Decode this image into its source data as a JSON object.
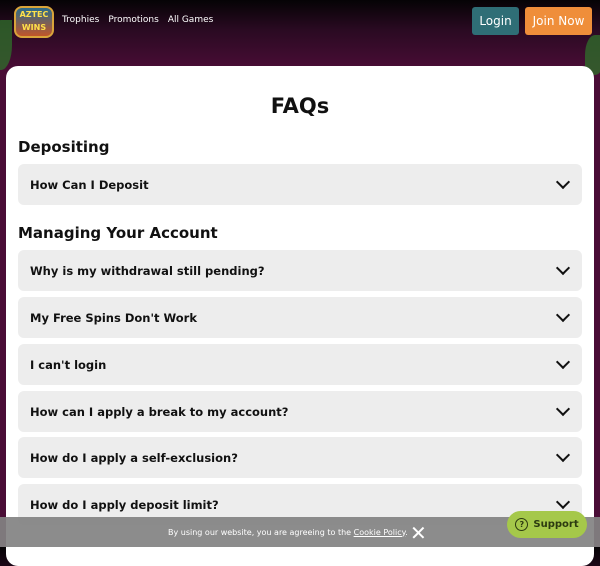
{
  "header": {
    "logo_text": "AZTEC WINS",
    "nav": [
      "Trophies",
      "Promotions",
      "All Games"
    ],
    "login": "Login",
    "join": "Join Now"
  },
  "page": {
    "title": "FAQs",
    "sections": [
      {
        "heading": "Depositing",
        "items": [
          "How Can I Deposit"
        ]
      },
      {
        "heading": "Managing Your Account",
        "items": [
          "Why is my withdrawal still pending?",
          "My Free Spins Don't Work",
          "I can't login",
          "How can I apply a break to my account?",
          "How do I apply a self-exclusion?",
          "How do I apply deposit limit?"
        ]
      }
    ]
  },
  "cookie": {
    "text": "By using our website, you are agreeing to the ",
    "link": "Cookie Policy",
    "end": "."
  },
  "support": {
    "label": "Support",
    "icon": "question-circle-icon"
  },
  "colors": {
    "login": "#2f6e76",
    "join": "#ef8e3a",
    "support": "#a5c84a"
  }
}
